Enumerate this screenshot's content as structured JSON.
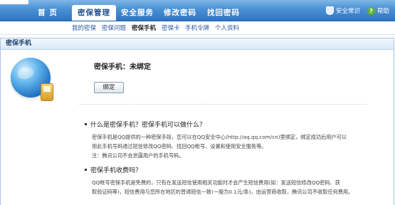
{
  "nav": {
    "tabs": [
      {
        "label": "首 页"
      },
      {
        "label": "密保管理"
      },
      {
        "label": "安全服务"
      },
      {
        "label": "修改密码"
      },
      {
        "label": "找回密码"
      }
    ],
    "right_links": [
      {
        "label": "安全常识",
        "icon": "shield-icon"
      },
      {
        "label": "帮助",
        "icon": "help-icon"
      }
    ]
  },
  "subnav": {
    "items": [
      {
        "label": "我的密保"
      },
      {
        "label": "密保问题"
      },
      {
        "label": "密保手机"
      },
      {
        "label": "密保卡"
      },
      {
        "label": "手机令牌"
      },
      {
        "label": "个人资料"
      }
    ]
  },
  "panel": {
    "title": "密保手机",
    "status": "密保手机：未绑定",
    "bind_button": "绑定"
  },
  "faq": [
    {
      "question": "什么是密保手机？密保手机可以做什么？",
      "answer": [
        "密保手机是QQ提供的一种密保手段，您可以在QQ安全中心(http://aq.qq.com/cn)里绑定，绑定成功后用户可以",
        "用此手机号码通过短信修改QQ密码、找回QQ帐号、设置和使用安全服务等。",
        "注：腾讯公司不会泄露用户的手机号码。"
      ]
    },
    {
      "question": "密保手机收费吗？",
      "answer": [
        "QQ帐号密保手机是免费的，只有在发送短信使用相关功能时才会产生短信费用(如：发送短信修改QQ密码、获",
        "取验证码等)，短信费用与您所在地区的普通短信一致(一般为0.1元/条)，由运营商收取，腾讯公司不收取任何费用。"
      ]
    }
  ]
}
